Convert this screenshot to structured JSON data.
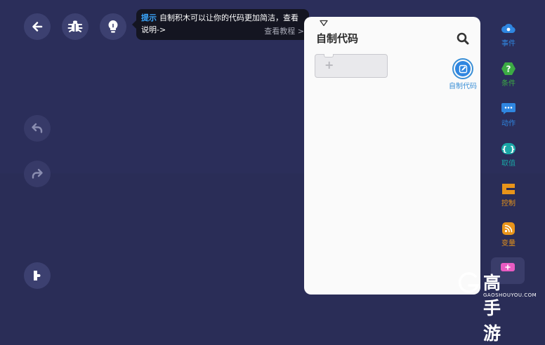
{
  "tooltip": {
    "key": "提示",
    "text": "自制积木可以让你的代码更加简洁，查看说明->",
    "link": "查看教程 >"
  },
  "panel": {
    "title": "自制代码",
    "new_block_symbol": "+"
  },
  "categories": [
    {
      "label": "事件",
      "icon": "cloud-icon",
      "color": "#2f86e0"
    },
    {
      "label": "条件",
      "icon": "question-hexagon-icon",
      "color": "#3cab44"
    },
    {
      "label": "动作",
      "icon": "chat-bubble-icon",
      "color": "#2f86e0"
    },
    {
      "label": "取值",
      "icon": "braces-icon",
      "color": "#1aa6a6"
    },
    {
      "label": "控制",
      "icon": "control-c-icon",
      "color": "#e8941a"
    },
    {
      "label": "变量",
      "icon": "rss-icon",
      "color": "#e8941a"
    }
  ],
  "custom_category": {
    "label": "自制代码",
    "icon": "pencil-square-icon",
    "color": "#2f86e0"
  },
  "watermark": {
    "main": "高手游",
    "sub": "GAOSHOUYOU.COM"
  }
}
